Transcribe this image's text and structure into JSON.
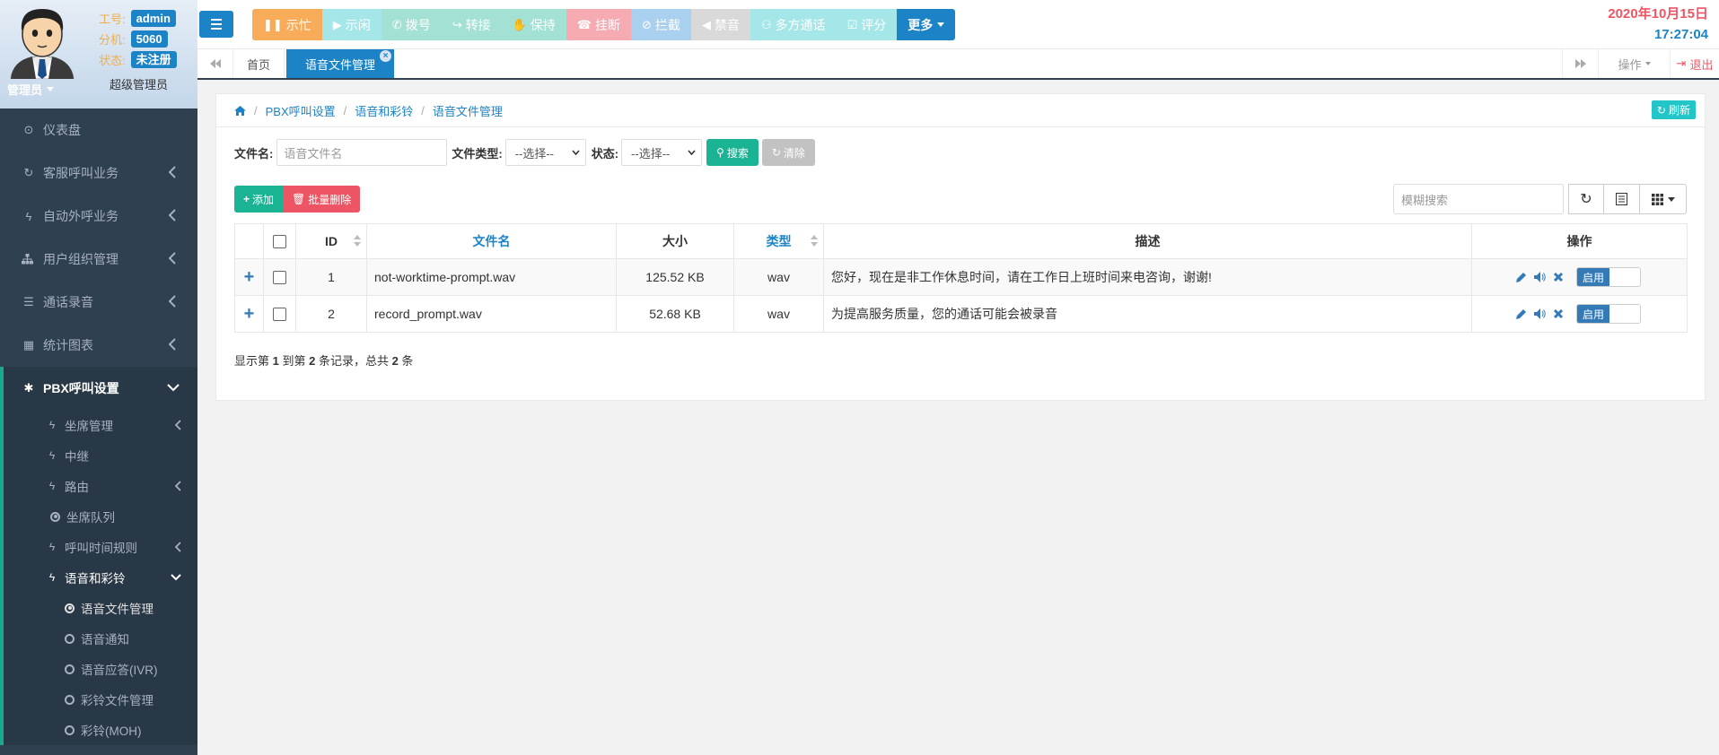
{
  "profile": {
    "fields": [
      {
        "label": "工号:",
        "value": "admin"
      },
      {
        "label": "分机:",
        "value": "5060"
      },
      {
        "label": "状态:",
        "value": "未注册"
      }
    ],
    "role_dropdown": "管理员",
    "role_name": "超级管理员"
  },
  "sidebar": {
    "items": [
      {
        "label": "仪表盘",
        "icon": "dashboard-icon"
      },
      {
        "label": "客服呼叫业务",
        "icon": "refresh-icon"
      },
      {
        "label": "自动外呼业务",
        "icon": "bolt-icon"
      },
      {
        "label": "用户组织管理",
        "icon": "sitemap-icon"
      },
      {
        "label": "通话录音",
        "icon": "list-icon"
      },
      {
        "label": "统计图表",
        "icon": "table-icon"
      },
      {
        "label": "PBX呼叫设置",
        "icon": "asterisk-icon"
      }
    ],
    "pbx_sub": [
      {
        "label": "坐席管理"
      },
      {
        "label": "中继"
      },
      {
        "label": "路由"
      },
      {
        "label": "坐席队列"
      },
      {
        "label": "呼叫时间规则"
      },
      {
        "label": "语音和彩铃"
      }
    ],
    "voice_sub": [
      {
        "label": "语音文件管理"
      },
      {
        "label": "语音通知"
      },
      {
        "label": "语音应答(IVR)"
      },
      {
        "label": "彩铃文件管理"
      },
      {
        "label": "彩铃(MOH)"
      }
    ]
  },
  "toolbar": {
    "buttons": [
      {
        "label": "示忙",
        "icon": "pause-icon",
        "color": "#f8ac59"
      },
      {
        "label": "示闲",
        "icon": "play-icon",
        "color": "#a5e7e8"
      },
      {
        "label": "拨号",
        "icon": "phone-icon",
        "color": "#a3e1d4"
      },
      {
        "label": "转接",
        "icon": "share-icon",
        "color": "#a3e1d4"
      },
      {
        "label": "保持",
        "icon": "hand-icon",
        "color": "#a3e1d4"
      },
      {
        "label": "挂断",
        "icon": "hangup-icon",
        "color": "#f6aab2"
      },
      {
        "label": "拦截",
        "icon": "ban-icon",
        "color": "#a9d0ef"
      },
      {
        "label": "禁音",
        "icon": "mute-icon",
        "color": "#d9d9d9"
      },
      {
        "label": "多方通话",
        "icon": "users-icon",
        "color": "#a5e7e8"
      },
      {
        "label": "评分",
        "icon": "check-square-icon",
        "color": "#a5e7e8"
      },
      {
        "label": "更多",
        "icon": "caret-down-icon",
        "color": "#1c84c6"
      }
    ]
  },
  "clock": {
    "date": "2020年10月15日",
    "time": "17:27:04"
  },
  "tabs": {
    "home": "首页",
    "active": "语音文件管理",
    "ops": "操作",
    "logout": "退出"
  },
  "breadcrumb": {
    "items": [
      "PBX呼叫设置",
      "语音和彩铃",
      "语音文件管理"
    ],
    "refresh": "刷新"
  },
  "filters": {
    "filename_label": "文件名:",
    "filename_placeholder": "语音文件名",
    "type_label": "文件类型:",
    "type_value": "--选择--",
    "status_label": "状态:",
    "status_value": "--选择--",
    "search": "搜索",
    "clear": "清除"
  },
  "actions": {
    "add": "添加",
    "batch_delete": "批量删除"
  },
  "table_tools": {
    "fuzzy_placeholder": "模糊搜索"
  },
  "table": {
    "headers": [
      "ID",
      "文件名",
      "大小",
      "类型",
      "描述",
      "操作"
    ],
    "rows": [
      {
        "id": "1",
        "filename": "not-worktime-prompt.wav",
        "size": "125.52 KB",
        "type": "wav",
        "desc": "您好，现在是非工作休息时间，请在工作日上班时间来电咨询，谢谢!",
        "toggle": "启用"
      },
      {
        "id": "2",
        "filename": "record_prompt.wav",
        "size": "52.68 KB",
        "type": "wav",
        "desc": "为提高服务质量，您的通话可能会被录音",
        "toggle": "启用"
      }
    ]
  },
  "pagination": {
    "prefix": "显示第 ",
    "from": "1",
    "mid1": " 到第 ",
    "to": "2",
    "mid2": " 条记录，总共 ",
    "total": "2",
    "suffix": " 条"
  }
}
